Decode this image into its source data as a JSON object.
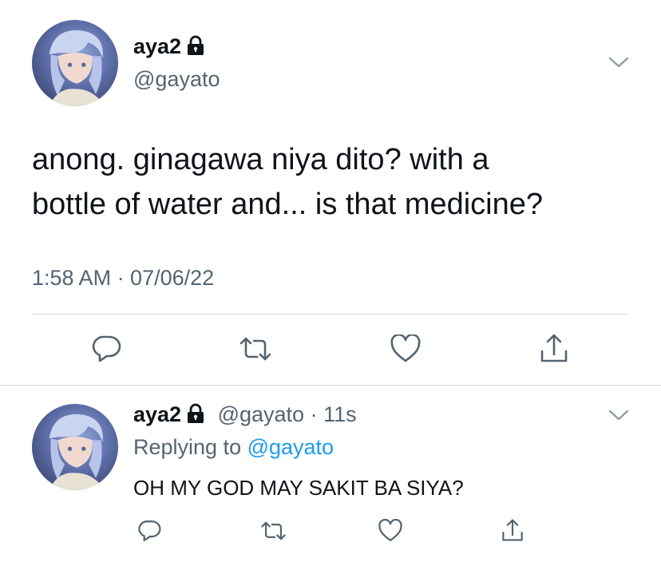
{
  "main_tweet": {
    "display_name": "aya2",
    "handle": "@gayato",
    "text_line1": "anong. ginagawa niya dito? with a",
    "text_line2": "bottle of water and... is that medicine?",
    "timestamp": "1:58 AM · 07/06/22"
  },
  "reply_tweet": {
    "display_name": "aya2",
    "handle_time": "@gayato · 11s",
    "replying_prefix": "Replying to ",
    "replying_to": "@gayato",
    "text": "OH MY GOD MAY SAKIT BA SIYA?"
  },
  "icons": [
    "lock-icon",
    "chevron-down-icon",
    "reply-icon",
    "retweet-icon",
    "like-icon",
    "share-icon"
  ],
  "colors": {
    "text": "#0f1419",
    "secondary": "#536471",
    "accent": "#1d9bf0",
    "divider": "#cfd9de"
  }
}
